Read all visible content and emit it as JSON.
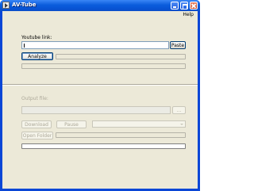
{
  "window": {
    "title": "AV-Tube"
  },
  "menu": {
    "help": "Help"
  },
  "youtube": {
    "label": "Youtube link:",
    "link_value": "",
    "paste_label": "Paste",
    "analyze_label": "Analyze"
  },
  "output": {
    "label": "Output file:",
    "browse_label": "...",
    "download_label": "Download",
    "pause_label": "Pause",
    "open_folder_label": "Open Folder",
    "format_value": ""
  },
  "colors": {
    "title_bar": "#0a5cdc",
    "client_bg": "#ece9d8",
    "button_border": "#003c74"
  }
}
